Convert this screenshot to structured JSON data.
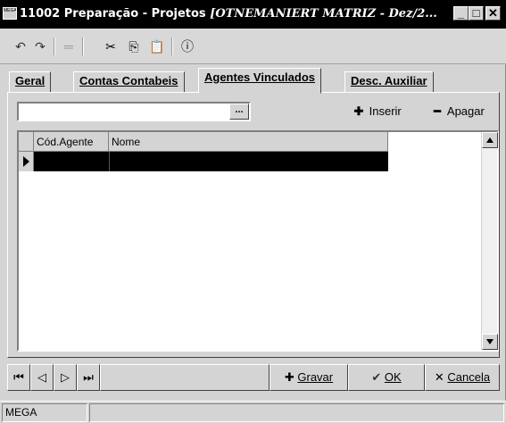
{
  "window": {
    "title_bold": "11002 Preparação - Projetos",
    "title_italic": "[OTNEMANIERT MATRIZ - Dez/2...",
    "icon_text": "MEGA"
  },
  "toolbar": {
    "undo_glyph": "↶",
    "redo_glyph": "↷",
    "minus_glyph": "═",
    "cut_glyph": "✂",
    "copy_glyph": "⎘",
    "paste_glyph": "📋",
    "info_glyph": "ⓘ"
  },
  "tabs": [
    {
      "label": "Geral",
      "active": false
    },
    {
      "label": "Contas Contabeis",
      "active": false
    },
    {
      "label": "Agentes Vinculados",
      "active": true
    },
    {
      "label": "Desc. Auxiliar",
      "active": false
    }
  ],
  "search": {
    "value": "",
    "button_label": "..."
  },
  "actions": {
    "inserir": "Inserir",
    "apagar": "Apagar"
  },
  "grid": {
    "columns": [
      "Cód.Agente",
      "Nome"
    ],
    "rows": [
      [
        "",
        ""
      ]
    ]
  },
  "navigation": {
    "first": "⏮",
    "prev": "◁",
    "next": "▷",
    "last": "⏭"
  },
  "commands": {
    "gravar": "Gravar",
    "ok": "OK",
    "cancela": "Cancela"
  },
  "status": {
    "text": "MEGA"
  }
}
